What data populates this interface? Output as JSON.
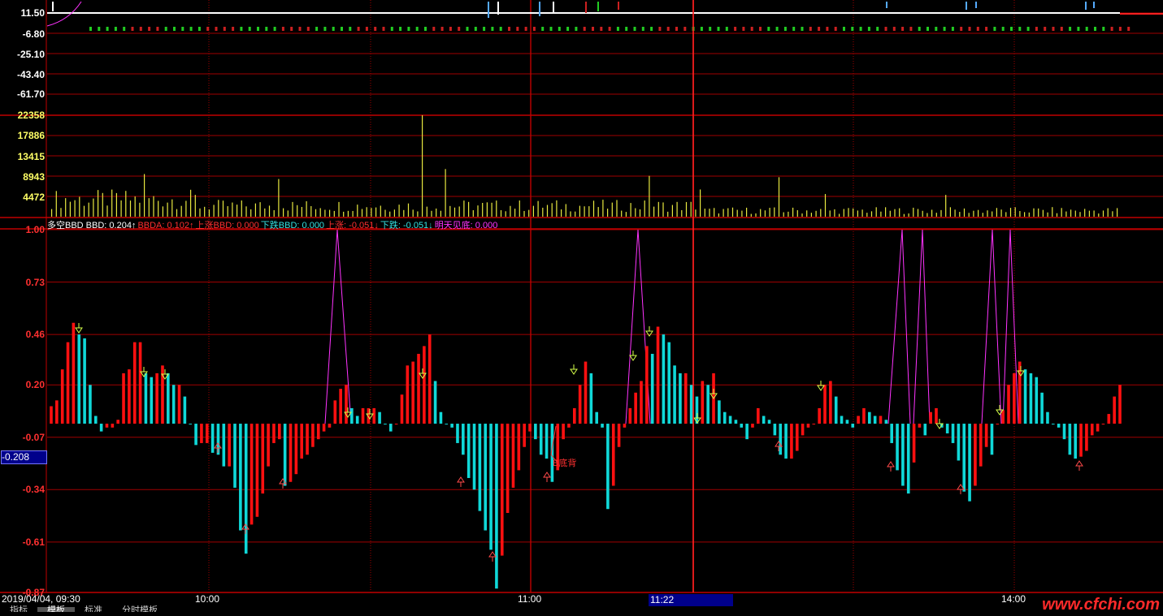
{
  "price_panel": {
    "ticks": [
      "11.50",
      "-6.80",
      "-25.10",
      "-43.40",
      "-61.70"
    ]
  },
  "volume_panel": {
    "ticks": [
      "22358",
      "17886",
      "13415",
      "8943",
      "4472"
    ]
  },
  "indicator_panel": {
    "legend": [
      {
        "text": "多空BBD BBD: 0.204↑",
        "color": "#ffffff"
      },
      {
        "text": "BBDA: 0.102↑",
        "color": "#ff3030"
      },
      {
        "text": "上涨BBD: 0.000",
        "color": "#ff3030"
      },
      {
        "text": "下跌BBD: 0.000",
        "color": "#33e0e0"
      },
      {
        "text": "上涨: -0.051↓",
        "color": "#ff3030"
      },
      {
        "text": "下跌: -0.051↓",
        "color": "#33e0e0"
      },
      {
        "text": "明天见底: 0.000",
        "color": "#ff33ff"
      }
    ],
    "ticks": [
      "1.00",
      "0.73",
      "0.46",
      "0.20",
      "-0.07",
      "-0.34",
      "-0.61",
      "-0.87"
    ],
    "annotation": "B底背",
    "crosshair_value": "-0.208"
  },
  "time_axis": {
    "date_time": "2019/04/04, 09:30",
    "labels": [
      "10:00",
      "11:00",
      "14:00"
    ],
    "crosshair_time": "11:22"
  },
  "bottom_tabs": [
    "指标",
    "模板",
    "标准",
    "分时模板"
  ],
  "watermark": "www.cfchi.com",
  "colors": {
    "up": "#ff1010",
    "down": "#10d8d8",
    "grid": "#a00000",
    "volume": "#e8e840",
    "magenta": "#ff33ff"
  },
  "chart_data": {
    "type": "bar",
    "title": "",
    "ylim": [
      -0.87,
      1.0
    ],
    "series": [
      {
        "name": "多空BBD",
        "values": [
          0.09,
          0.12,
          0.28,
          0.42,
          0.52,
          0.46,
          0.44,
          0.2,
          0.04,
          -0.04,
          -0.02,
          -0.02,
          0.02,
          0.26,
          0.28,
          0.42,
          0.42,
          0.26,
          0.24,
          0.26,
          0.3,
          0.26,
          0.2,
          0.2,
          0.14,
          0.0,
          -0.11,
          -0.1,
          -0.1,
          -0.15,
          -0.16,
          -0.22,
          -0.22,
          -0.33,
          -0.55,
          -0.67,
          -0.52,
          -0.48,
          -0.36,
          -0.22,
          -0.1,
          -0.08,
          -0.32,
          -0.3,
          -0.26,
          -0.18,
          -0.16,
          -0.12,
          -0.08,
          -0.04,
          -0.02,
          0.12,
          0.18,
          0.2,
          0.08,
          0.04,
          0.08,
          0.08,
          0.08,
          0.06,
          0.0,
          -0.04,
          0.0,
          0.15,
          0.3,
          0.32,
          0.36,
          0.4,
          0.46,
          0.22,
          0.06,
          0.0,
          -0.02,
          -0.1,
          -0.16,
          -0.28,
          -0.34,
          -0.45,
          -0.55,
          -0.65,
          -0.85,
          -0.68,
          -0.46,
          -0.33,
          -0.24,
          -0.12,
          -0.04,
          -0.08,
          -0.16,
          -0.18,
          -0.3,
          -0.24,
          -0.08,
          -0.02,
          0.08,
          0.2,
          0.32,
          0.26,
          0.06,
          -0.02,
          -0.44,
          -0.32,
          -0.12,
          -0.02,
          0.08,
          0.16,
          0.22,
          0.4,
          0.36,
          0.5,
          0.46,
          0.42,
          0.3,
          0.26,
          0.26,
          0.2,
          0.14,
          0.22,
          0.2,
          0.26,
          0.12,
          0.06,
          0.04,
          0.02,
          -0.02,
          -0.08,
          -0.02,
          0.08,
          0.04,
          0.02,
          -0.06,
          -0.16,
          -0.18,
          -0.18,
          -0.14,
          -0.06,
          -0.02,
          0.0,
          0.08,
          0.2,
          0.22,
          0.14,
          0.04,
          0.02,
          -0.02,
          0.04,
          0.08,
          0.06,
          0.04,
          0.04,
          0.02,
          -0.1,
          -0.24,
          -0.32,
          -0.36,
          -0.2,
          -0.02,
          -0.06,
          0.06,
          0.08,
          -0.02,
          -0.05,
          -0.1,
          -0.19,
          -0.35,
          -0.4,
          -0.32,
          -0.22,
          -0.12,
          -0.16,
          0.0,
          0.07,
          0.2,
          0.26,
          0.32,
          0.28,
          0.26,
          0.24,
          0.16,
          0.06,
          0.0,
          -0.02,
          -0.08,
          -0.16,
          -0.18,
          -0.17,
          -0.14,
          -0.06,
          -0.04,
          0.0,
          0.05,
          0.14,
          0.2
        ]
      }
    ]
  }
}
